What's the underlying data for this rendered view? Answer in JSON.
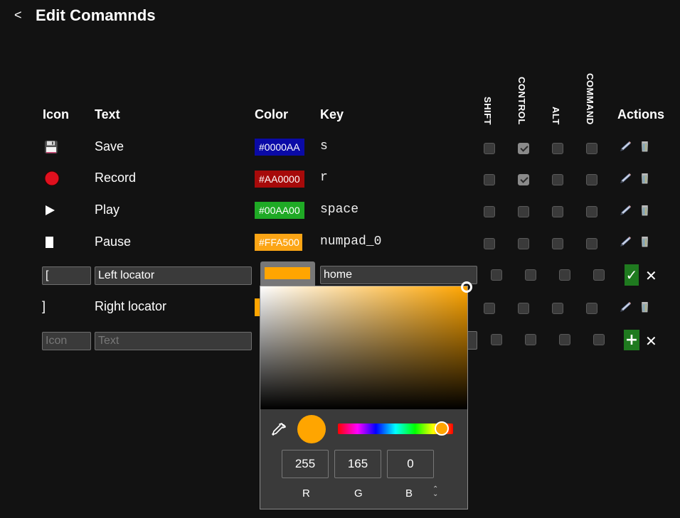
{
  "header": {
    "back_label": "<",
    "title": "Edit Comamnds"
  },
  "columns": {
    "icon": "Icon",
    "text": "Text",
    "color": "Color",
    "key": "Key",
    "shift": "SHIFT",
    "control": "CONTROL",
    "alt": "ALT",
    "command": "COMMAND",
    "actions": "Actions"
  },
  "commands": [
    {
      "icon": "floppy-disk",
      "text": "Save",
      "color": "#0000AA",
      "key": "s",
      "shift": false,
      "control": true,
      "alt": false,
      "command": false
    },
    {
      "icon": "red-circle",
      "text": "Record",
      "color": "#AA0000",
      "key": "r",
      "shift": false,
      "control": true,
      "alt": false,
      "command": false
    },
    {
      "icon": "play-triangle",
      "text": "Play",
      "color": "#00AA00",
      "key": "space",
      "shift": false,
      "control": false,
      "alt": false,
      "command": false
    },
    {
      "icon": "pause-bar",
      "text": "Pause",
      "color": "#FFA500",
      "key": "numpad_0",
      "shift": false,
      "control": false,
      "alt": false,
      "command": false
    }
  ],
  "editing_row": {
    "icon_value": "[",
    "text_value": "Left locator",
    "color": "#FFA500",
    "key_value": "home",
    "shift": false,
    "control": false,
    "alt": false,
    "command": false,
    "confirm_label": "✓",
    "cancel_label": "✕"
  },
  "right_locator_row": {
    "icon": "]",
    "text": "Right locator",
    "color": "#FFA500",
    "shift": false,
    "control": false,
    "alt": false,
    "command": false
  },
  "new_row": {
    "icon_placeholder": "Icon",
    "text_placeholder": "Text",
    "add_label": "+",
    "cancel_label": "✕"
  },
  "color_picker": {
    "color": "#FFA500",
    "hue_color": "#FFA500",
    "hue_fraction": 0.9,
    "r": "255",
    "g": "165",
    "b": "0",
    "r_label": "R",
    "g_label": "G",
    "b_label": "B",
    "mode_toggle": "⌃⌄"
  },
  "colors": {
    "background": "#121212",
    "checkbox_bg": "#3a3a3a",
    "checkbox_checked": "#8a8a8a",
    "confirm_green": "#1f7a1f",
    "record_red": "#e0101e"
  }
}
